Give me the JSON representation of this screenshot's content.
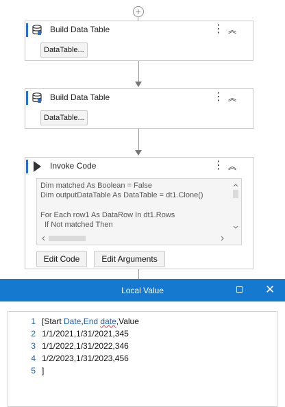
{
  "workflow": {
    "activities": [
      {
        "title": "Build Data Table",
        "button": "DataTable..."
      },
      {
        "title": "Build Data Table",
        "button": "DataTable..."
      },
      {
        "title": "Invoke Code",
        "code_lines": [
          "Dim matched As Boolean = False",
          "Dim outputDataTable As DataTable = dt1.Clone()",
          "",
          "For Each row1 As DataRow In dt1.Rows",
          "  If Not matched Then"
        ],
        "edit_code_label": "Edit Code",
        "edit_arguments_label": "Edit Arguments"
      }
    ],
    "add_symbol": "+"
  },
  "dialog": {
    "title": "Local Value",
    "lines": [
      {
        "number": "1",
        "text_a": "[Start ",
        "text_b": "Date",
        "text_c": ",",
        "text_d": "End ",
        "text_e": "date",
        "text_f": ",Value"
      },
      {
        "number": "2",
        "text": "1/1/2021,1/31/2021,345"
      },
      {
        "number": "3",
        "text": "1/1/2022,1/31/2022,346"
      },
      {
        "number": "4",
        "text": "1/2/2023,1/31/2023,456"
      },
      {
        "number": "5",
        "text": "]"
      }
    ]
  },
  "colors": {
    "titlebar": "#1479cf",
    "accent": "#2a6fc9"
  }
}
